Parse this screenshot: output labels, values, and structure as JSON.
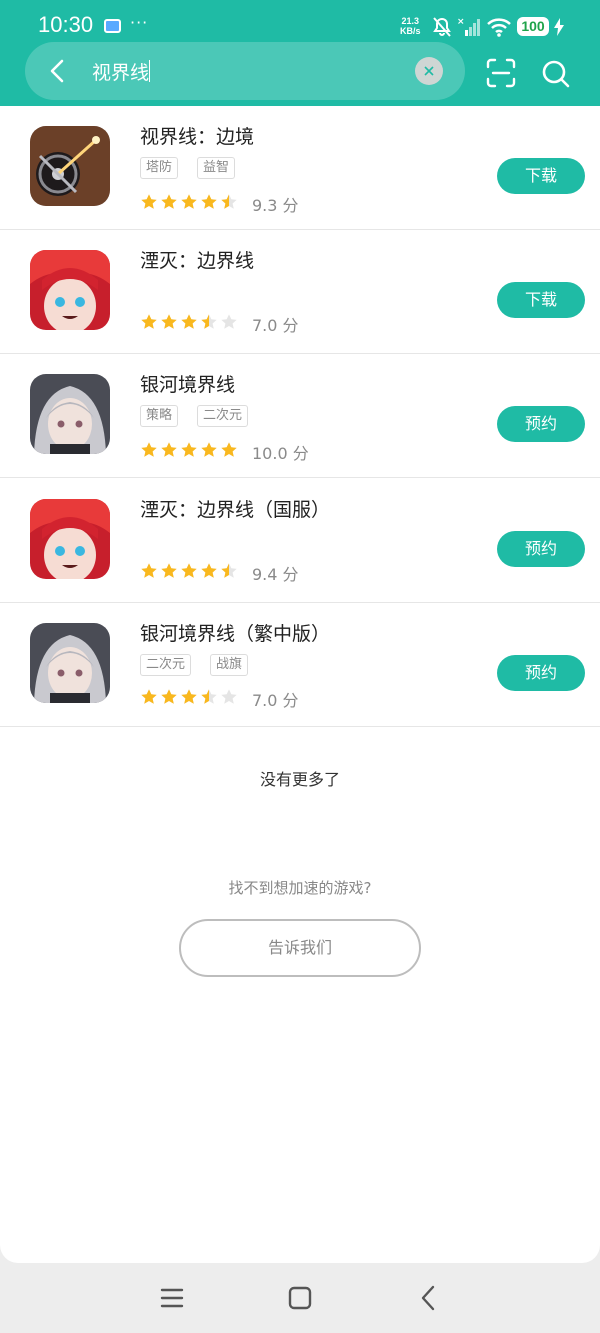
{
  "status_bar": {
    "time": "10:30",
    "dots": "···",
    "net_speed": "21.3",
    "net_unit": "KB/s",
    "battery": "100"
  },
  "search": {
    "query": "视界线"
  },
  "results": [
    {
      "title": "视界线：边境",
      "tags": [
        "塔防",
        "益智"
      ],
      "rating": 4.5,
      "score": "9.3 分",
      "action": "下载"
    },
    {
      "title": "湮灭：边界线",
      "tags": [],
      "rating": 3.5,
      "score": "7.0 分",
      "action": "下载"
    },
    {
      "title": "银河境界线",
      "tags": [
        "策略",
        "二次元"
      ],
      "rating": 5,
      "score": "10.0 分",
      "action": "预约"
    },
    {
      "title": "湮灭：边界线（国服）",
      "tags": [],
      "rating": 4.5,
      "score": "9.4 分",
      "action": "预约"
    },
    {
      "title": "银河境界线（繁中版）",
      "tags": [
        "二次元",
        "战旗"
      ],
      "rating": 3.5,
      "score": "7.0 分",
      "action": "预约"
    }
  ],
  "footer": {
    "no_more": "没有更多了",
    "cant_find": "找不到想加速的游戏?",
    "tell_us": "告诉我们"
  },
  "colors": {
    "accent": "#1fbba5",
    "star": "#f9b81e",
    "star_empty": "#e5e5e5"
  }
}
